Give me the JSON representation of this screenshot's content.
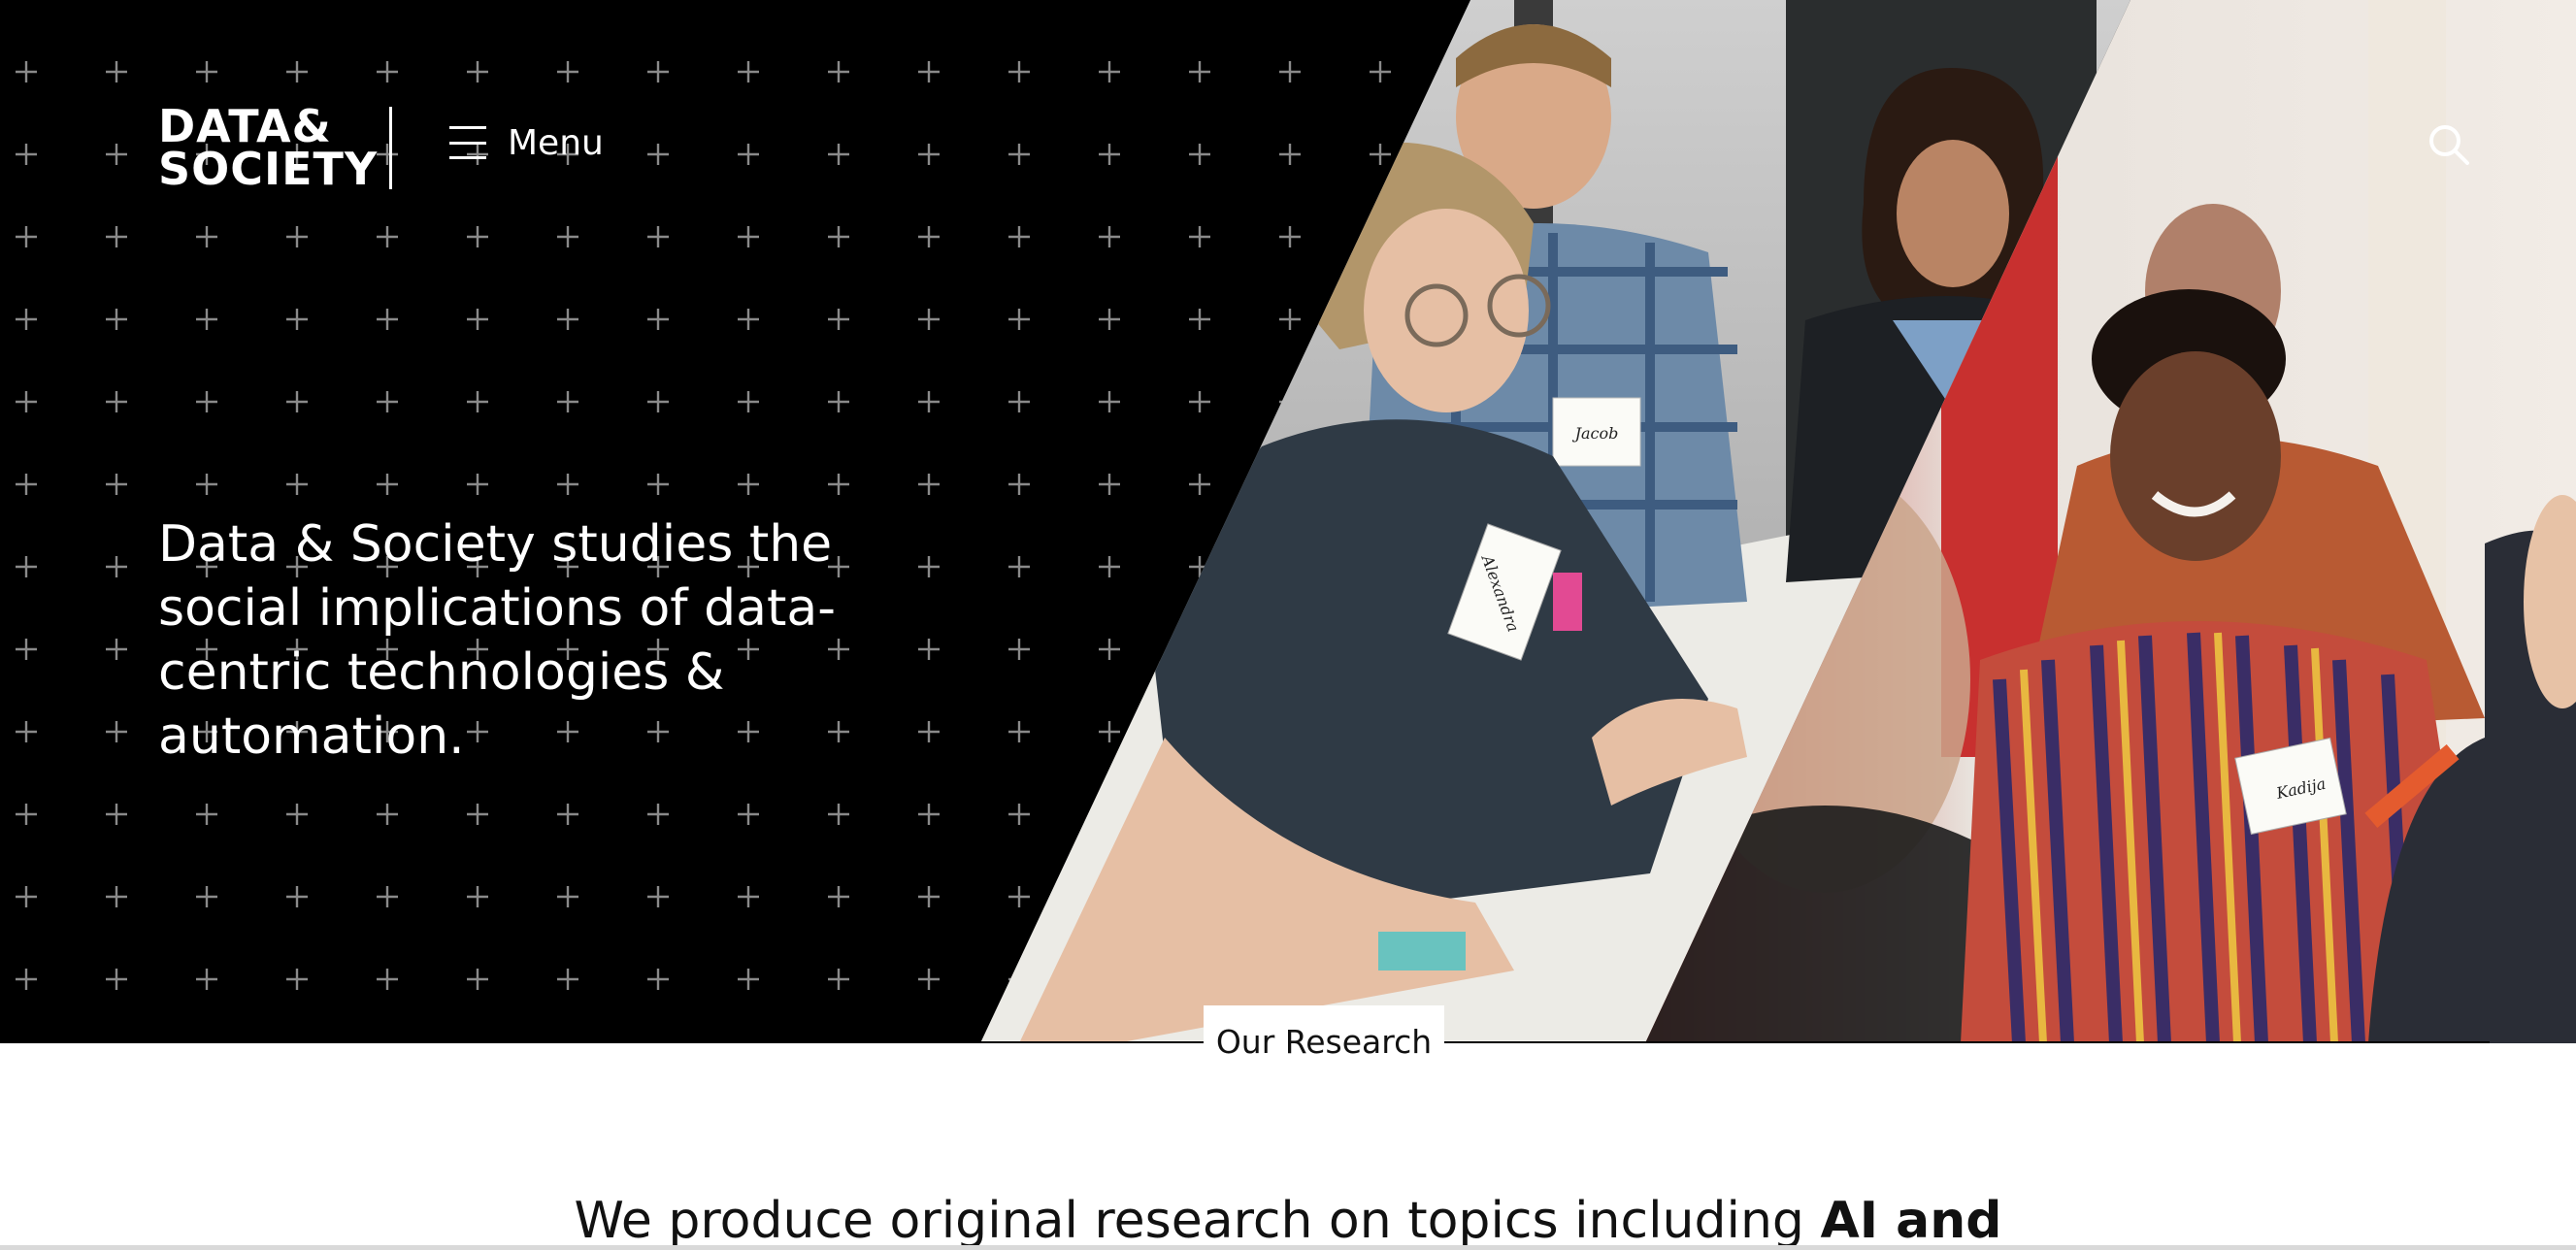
{
  "header": {
    "logo_line1": "DATA&",
    "logo_line2": "SOCIETY",
    "menu_label": "Menu",
    "menu_icon": "hamburger-icon",
    "search_icon": "search-icon"
  },
  "hero": {
    "heading": "Data & Society studies the social implications of data-centric technologies & automation.",
    "name_tags": [
      "Jacob",
      "Alexandra",
      "Kadija"
    ]
  },
  "section": {
    "label": "Our Research"
  },
  "intro": {
    "text_regular": "We produce original research on topics including ",
    "text_bold": "AI and"
  },
  "colors": {
    "hero_background": "#000000",
    "text_on_dark": "#ffffff",
    "grid_plus": "#8a8a8a",
    "accent_orange": "#e97a3a"
  }
}
